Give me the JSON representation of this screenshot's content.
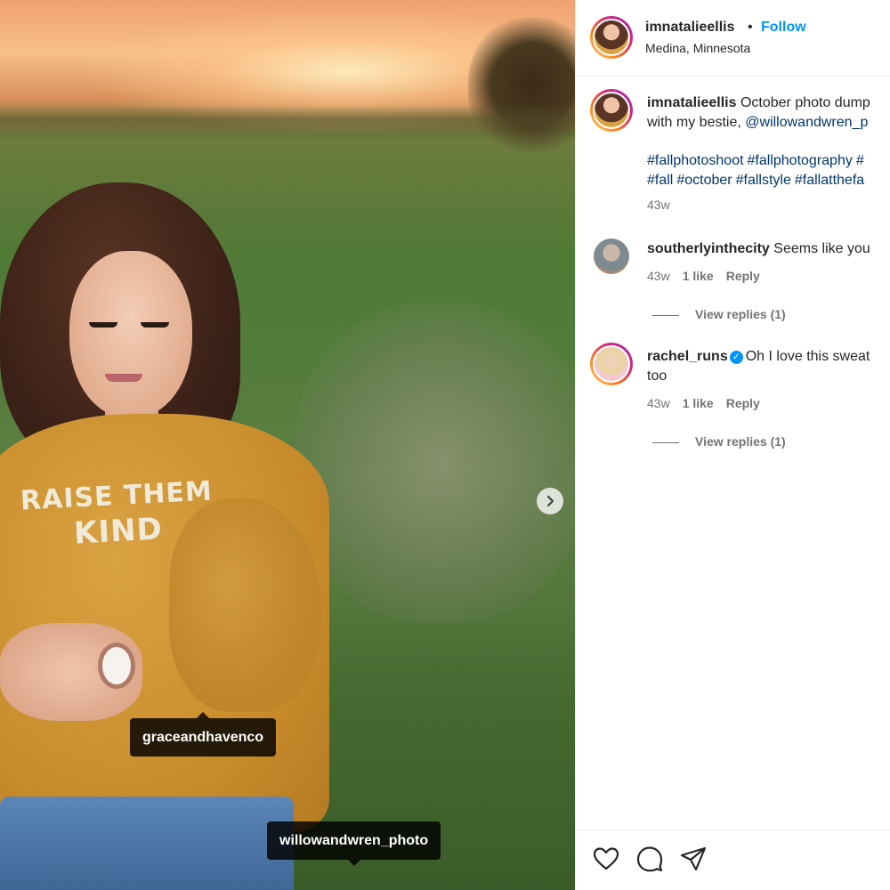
{
  "post": {
    "username": "imnatalieellis",
    "separator": "•",
    "follow_label": "Follow",
    "location": "Medina, Minnesota",
    "caption": {
      "username": "imnatalieellis",
      "text_line1": "October photo dump",
      "text_line2_prefix": "with my bestie,",
      "mention": "@willowandwren_p",
      "hashtags_line1": [
        "#fallphotoshoot",
        "#fallphotography",
        "#"
      ],
      "hashtags_line2": [
        "#fall",
        "#october",
        "#fallstyle",
        "#fallatthefa"
      ],
      "time": "43w"
    }
  },
  "photo": {
    "sweater_print_line1": "RAISE THEM",
    "sweater_print_line2": "KIND",
    "tags": [
      "graceandhavenco",
      "willowandwren_photo"
    ],
    "next_icon": "chevron-right-icon"
  },
  "comments": [
    {
      "username": "southerlyinthecity",
      "text": "Seems like you",
      "time": "43w",
      "likes": "1 like",
      "reply_label": "Reply",
      "view_replies": "View replies (1)"
    },
    {
      "username": "rachel_runs",
      "verified_icon": "verified-badge-icon",
      "text": "Oh I love this sweat",
      "text_line2": "too",
      "time": "43w",
      "likes": "1 like",
      "reply_label": "Reply",
      "view_replies": "View replies (1)"
    }
  ],
  "actions": [
    "heart-icon",
    "comment-icon",
    "share-icon"
  ],
  "colors": {
    "accent": "#0095f6",
    "link": "#00376b",
    "muted": "#737373",
    "text": "#262626"
  }
}
